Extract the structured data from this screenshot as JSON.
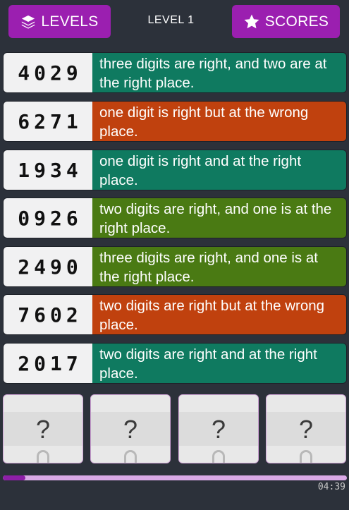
{
  "header": {
    "levels_label": "LEVELS",
    "level_title": "LEVEL 1",
    "scores_label": "SCORES"
  },
  "clues": [
    {
      "code": "4029",
      "hint": "three digits are right, and two are at the right place.",
      "color": "#0f7a60"
    },
    {
      "code": "6271",
      "hint": "one digit is right but at the wrong place.",
      "color": "#c0410e"
    },
    {
      "code": "1934",
      "hint": "one digit is right and at the right place.",
      "color": "#0f7a60"
    },
    {
      "code": "0926",
      "hint": "two digits are right, and one is at the right place.",
      "color": "#4a7a13"
    },
    {
      "code": "2490",
      "hint": "three digits are right, and one is at the right place.",
      "color": "#4a7a13"
    },
    {
      "code": "7602",
      "hint": "two digits are right but at the wrong place.",
      "color": "#c0410e"
    },
    {
      "code": "2017",
      "hint": "two digits are right and at the right place.",
      "color": "#0f7a60"
    }
  ],
  "answer_slots": [
    {
      "value": "?",
      "next": "0"
    },
    {
      "value": "?",
      "next": "0"
    },
    {
      "value": "?",
      "next": "0"
    },
    {
      "value": "?",
      "next": "0"
    }
  ],
  "progress": {
    "fraction": 0.065
  },
  "timer": "04:39",
  "colors": {
    "background": "#2c313a",
    "button": "#9b1fb0",
    "green": "#0f7a60",
    "olive": "#4a7a13",
    "orange": "#c0410e"
  }
}
